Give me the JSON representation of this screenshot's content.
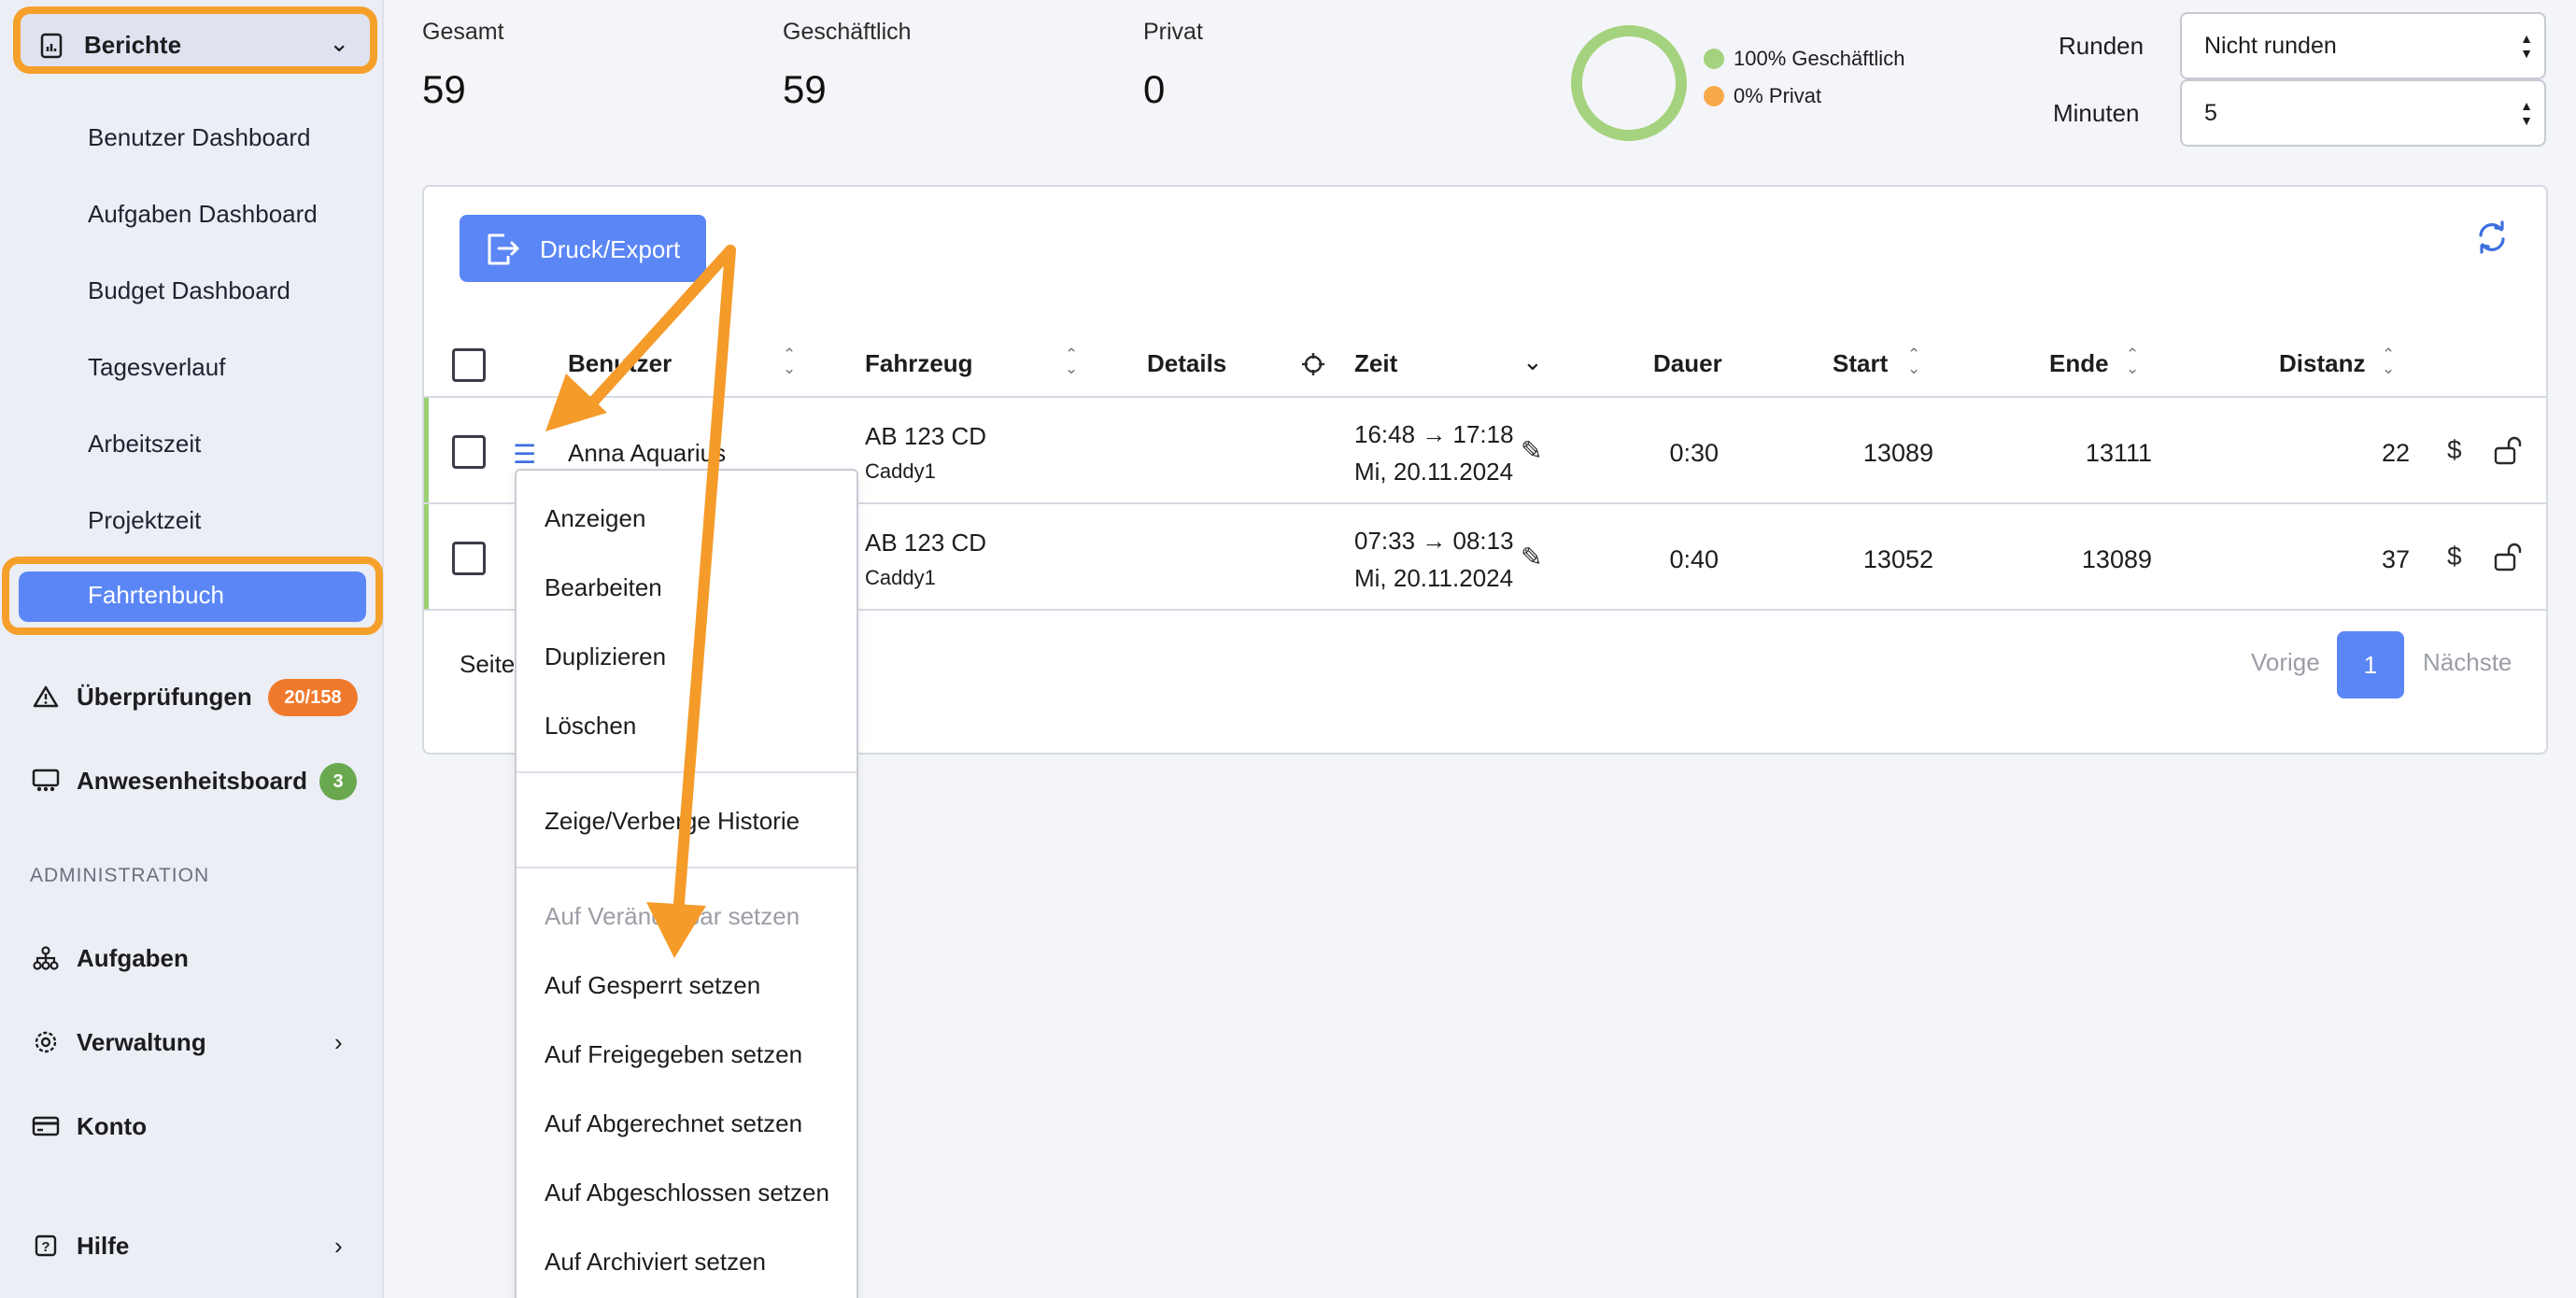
{
  "sidebar": {
    "header": {
      "label": "Berichte"
    },
    "sub_items": [
      "Benutzer Dashboard",
      "Aufgaben Dashboard",
      "Budget Dashboard",
      "Tagesverlauf",
      "Arbeitszeit",
      "Projektzeit"
    ],
    "active_item": "Fahrtenbuch",
    "checks": {
      "label": "Überprüfungen",
      "badge": "20/158"
    },
    "presence": {
      "label": "Anwesenheitsboard",
      "badge": "3"
    },
    "section_title": "ADMINISTRATION",
    "admin_items": [
      "Aufgaben",
      "Verwaltung",
      "Konto",
      "Hilfe"
    ]
  },
  "stats": {
    "total": {
      "label": "Gesamt",
      "value": "59"
    },
    "business": {
      "label": "Geschäftlich",
      "value": "59"
    },
    "private": {
      "label": "Privat",
      "value": "0"
    },
    "legend": [
      {
        "label": "100% Geschäftlich",
        "color": "#a5d27e"
      },
      {
        "label": "0% Privat",
        "color": "#f7a94a"
      }
    ]
  },
  "controls": {
    "rounding": {
      "label": "Runden",
      "value": "Nicht runden"
    },
    "minutes": {
      "label": "Minuten",
      "value": "5"
    }
  },
  "toolbar": {
    "export_label": "Druck/Export"
  },
  "table": {
    "headers": {
      "user": "Benutzer",
      "vehicle": "Fahrzeug",
      "details": "Details",
      "time": "Zeit",
      "duration": "Dauer",
      "start": "Start",
      "end": "Ende",
      "distance": "Distanz"
    },
    "rows": [
      {
        "user": "Anna Aquarius",
        "plate": "AB 123 CD",
        "model": "Caddy1",
        "time": "16:48 → 17:18",
        "date": "Mi, 20.11.2024",
        "duration": "0:30",
        "start": "13089",
        "end": "13111",
        "distance": "22"
      },
      {
        "user": "",
        "plate": "AB 123 CD",
        "model": "Caddy1",
        "time": "07:33 → 08:13",
        "date": "Mi, 20.11.2024",
        "duration": "0:40",
        "start": "13052",
        "end": "13089",
        "distance": "37"
      }
    ]
  },
  "pagination": {
    "page_label": "Seite",
    "prev": "Vorige",
    "current": "1",
    "next": "Nächste"
  },
  "context_menu": {
    "group1": [
      "Anzeigen",
      "Bearbeiten",
      "Duplizieren",
      "Löschen"
    ],
    "group2": [
      "Zeige/Verberge Historie"
    ],
    "disabled_item": "Auf Veränderbar setzen",
    "group3": [
      "Auf Gesperrt setzen",
      "Auf Freigegeben setzen",
      "Auf Abgerechnet setzen",
      "Auf Abgeschlossen setzen",
      "Auf Archiviert setzen"
    ]
  },
  "colors": {
    "accent": "#5b86f5",
    "highlight": "#f5a02a",
    "success": "#9ccf72",
    "warning_badge": "#f07a2c",
    "ok_badge": "#6aa84f"
  }
}
